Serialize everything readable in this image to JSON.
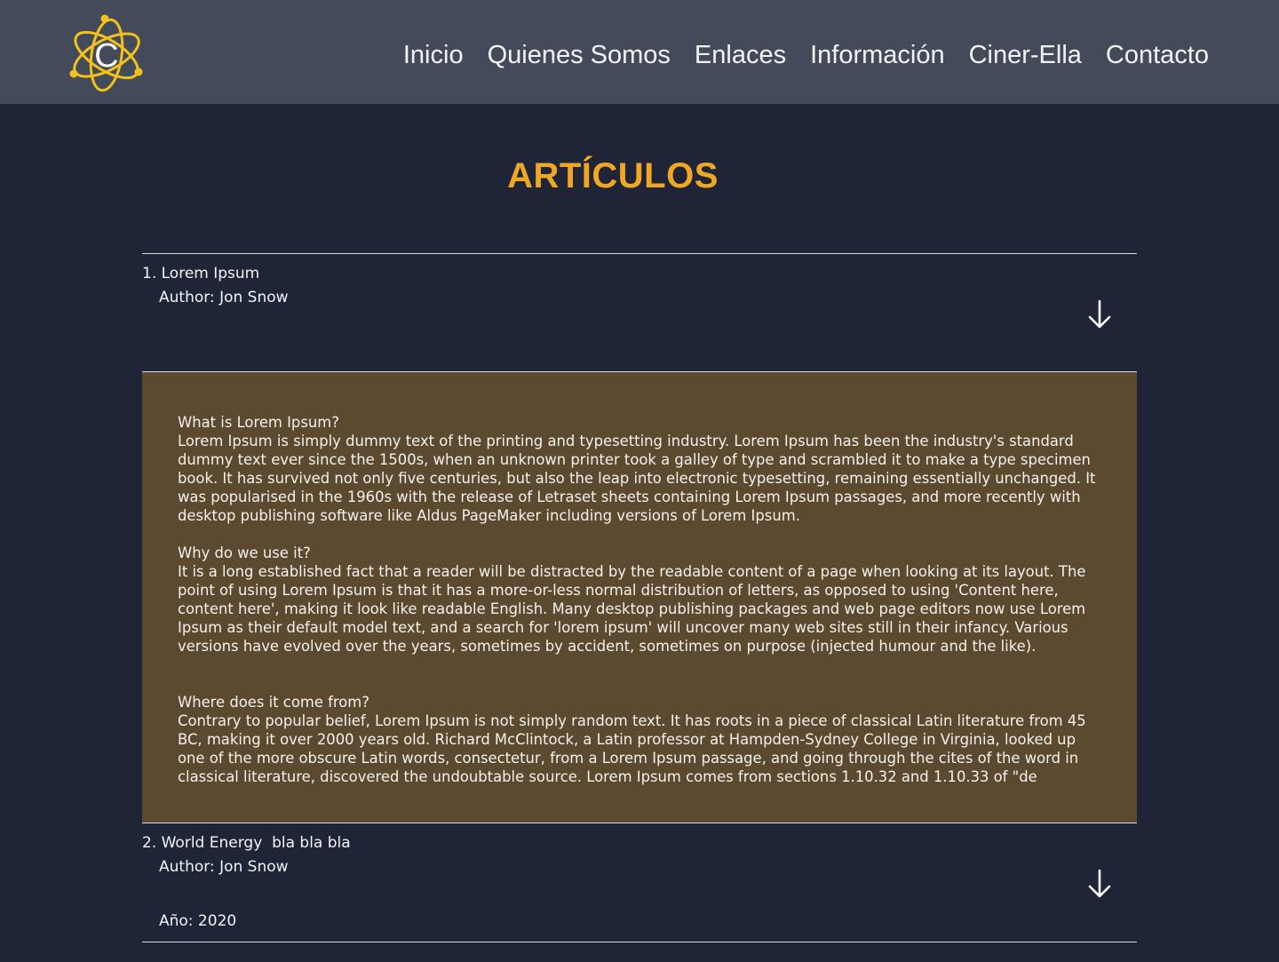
{
  "nav": {
    "logo_letter": "C",
    "links": [
      "Inicio",
      "Quienes Somos",
      "Enlaces",
      "Información",
      "Ciner-Ella",
      "Contacto"
    ]
  },
  "page": {
    "title": "ARTÍCULOS"
  },
  "articles": [
    {
      "title": "1. Lorem Ipsum",
      "author": "Author: Jon Snow",
      "expanded": true,
      "sections": [
        {
          "q": "What is Lorem Ipsum?",
          "p": "Lorem Ipsum is simply dummy text of the printing and typesetting industry. Lorem Ipsum has been the industry's standard dummy text ever since the 1500s, when an unknown printer took a galley of type and scrambled it to make a type specimen book. It has survived not only five centuries, but also the leap into electronic typesetting, remaining essentially unchanged. It was popularised in the 1960s with the release of Letraset sheets containing Lorem Ipsum passages, and more recently with desktop publishing software like Aldus PageMaker including versions of Lorem Ipsum."
        },
        {
          "q": "Why do we use it?",
          "p": "It is a long established fact that a reader will be distracted by the readable content of a page when looking at its layout. The point of using Lorem Ipsum is that it has a more-or-less normal distribution of letters, as opposed to using 'Content here, content here', making it look like readable English. Many desktop publishing packages and web page editors now use Lorem Ipsum as their default model text, and a search for 'lorem ipsum' will uncover many web sites still in their infancy. Various versions have evolved over the years, sometimes by accident, sometimes on purpose (injected humour and the like)."
        },
        {
          "q": "Where does it come from?",
          "p": "Contrary to popular belief, Lorem Ipsum is not simply random text. It has roots in a piece of classical Latin literature from 45 BC, making it over 2000 years old. Richard McClintock, a Latin professor at Hampden-Sydney College in Virginia, looked up one of the more obscure Latin words, consectetur, from a Lorem Ipsum passage, and going through the cites of the word in classical literature, discovered the undoubtable source. Lorem Ipsum comes from sections 1.10.32 and 1.10.33 of \"de"
        }
      ]
    },
    {
      "title": "2. World Energy  bla bla bla",
      "author": "Author: Jon Snow",
      "year": "Año: 2020",
      "expanded": false
    }
  ],
  "colors": {
    "navbar_bg": "#434b5b",
    "page_bg": "#1f2536",
    "accent": "#f0a724",
    "article_body_bg": "#5b4a30",
    "divider": "#d9dbe0"
  },
  "icons": {
    "logo": "atom-logo-icon",
    "expand": "arrow-down-icon"
  }
}
